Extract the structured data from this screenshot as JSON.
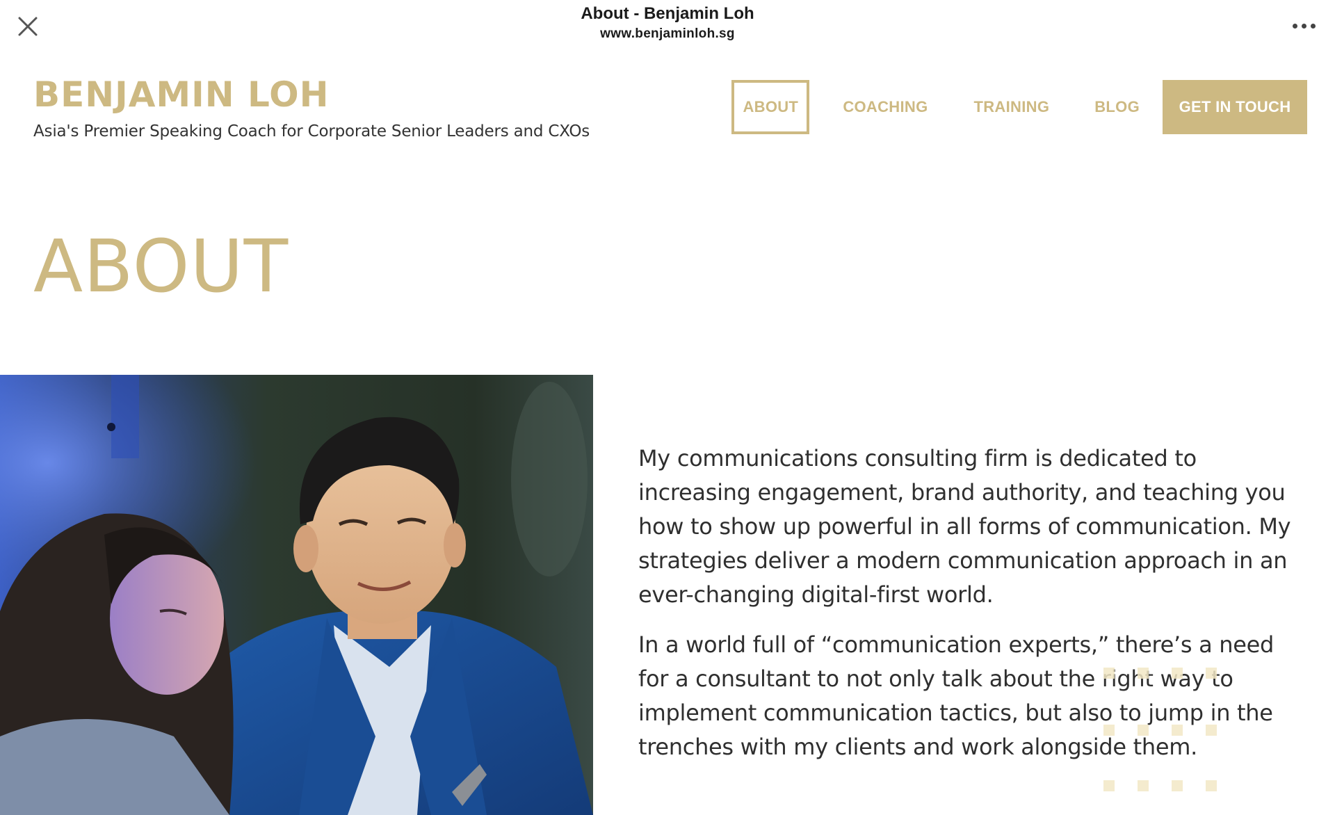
{
  "browser": {
    "title": "About - Benjamin Loh",
    "url": "www.benjaminloh.sg",
    "close_icon": "close-icon",
    "more_icon": "more-horizontal-icon"
  },
  "site": {
    "logo": "BENJAMIN LOH",
    "tagline": "Asia's Premier Speaking Coach for Corporate Senior Leaders and CXOs"
  },
  "nav": {
    "items": [
      {
        "label": "ABOUT",
        "active": true
      },
      {
        "label": "COACHING"
      },
      {
        "label": "TRAINING"
      },
      {
        "label": "BLOG"
      },
      {
        "label": "GET IN TOUCH"
      }
    ]
  },
  "main": {
    "heading": "ABOUT",
    "paragraphs": [
      "My communications consulting firm is dedicated to increasing engagement, brand authority, and teaching you how to show up powerful in all forms of communication. My strategies deliver a modern communication approach in an ever-changing digital-first world.",
      "In a world full of “communication experts,” there’s a need for a consultant to not only talk about the right way to implement communication tactics, but also to jump in the trenches with my clients and work alongside them."
    ]
  },
  "colors": {
    "accent_gold": "#cdb982",
    "text": "#2f2f2f",
    "background": "#ffffff"
  }
}
